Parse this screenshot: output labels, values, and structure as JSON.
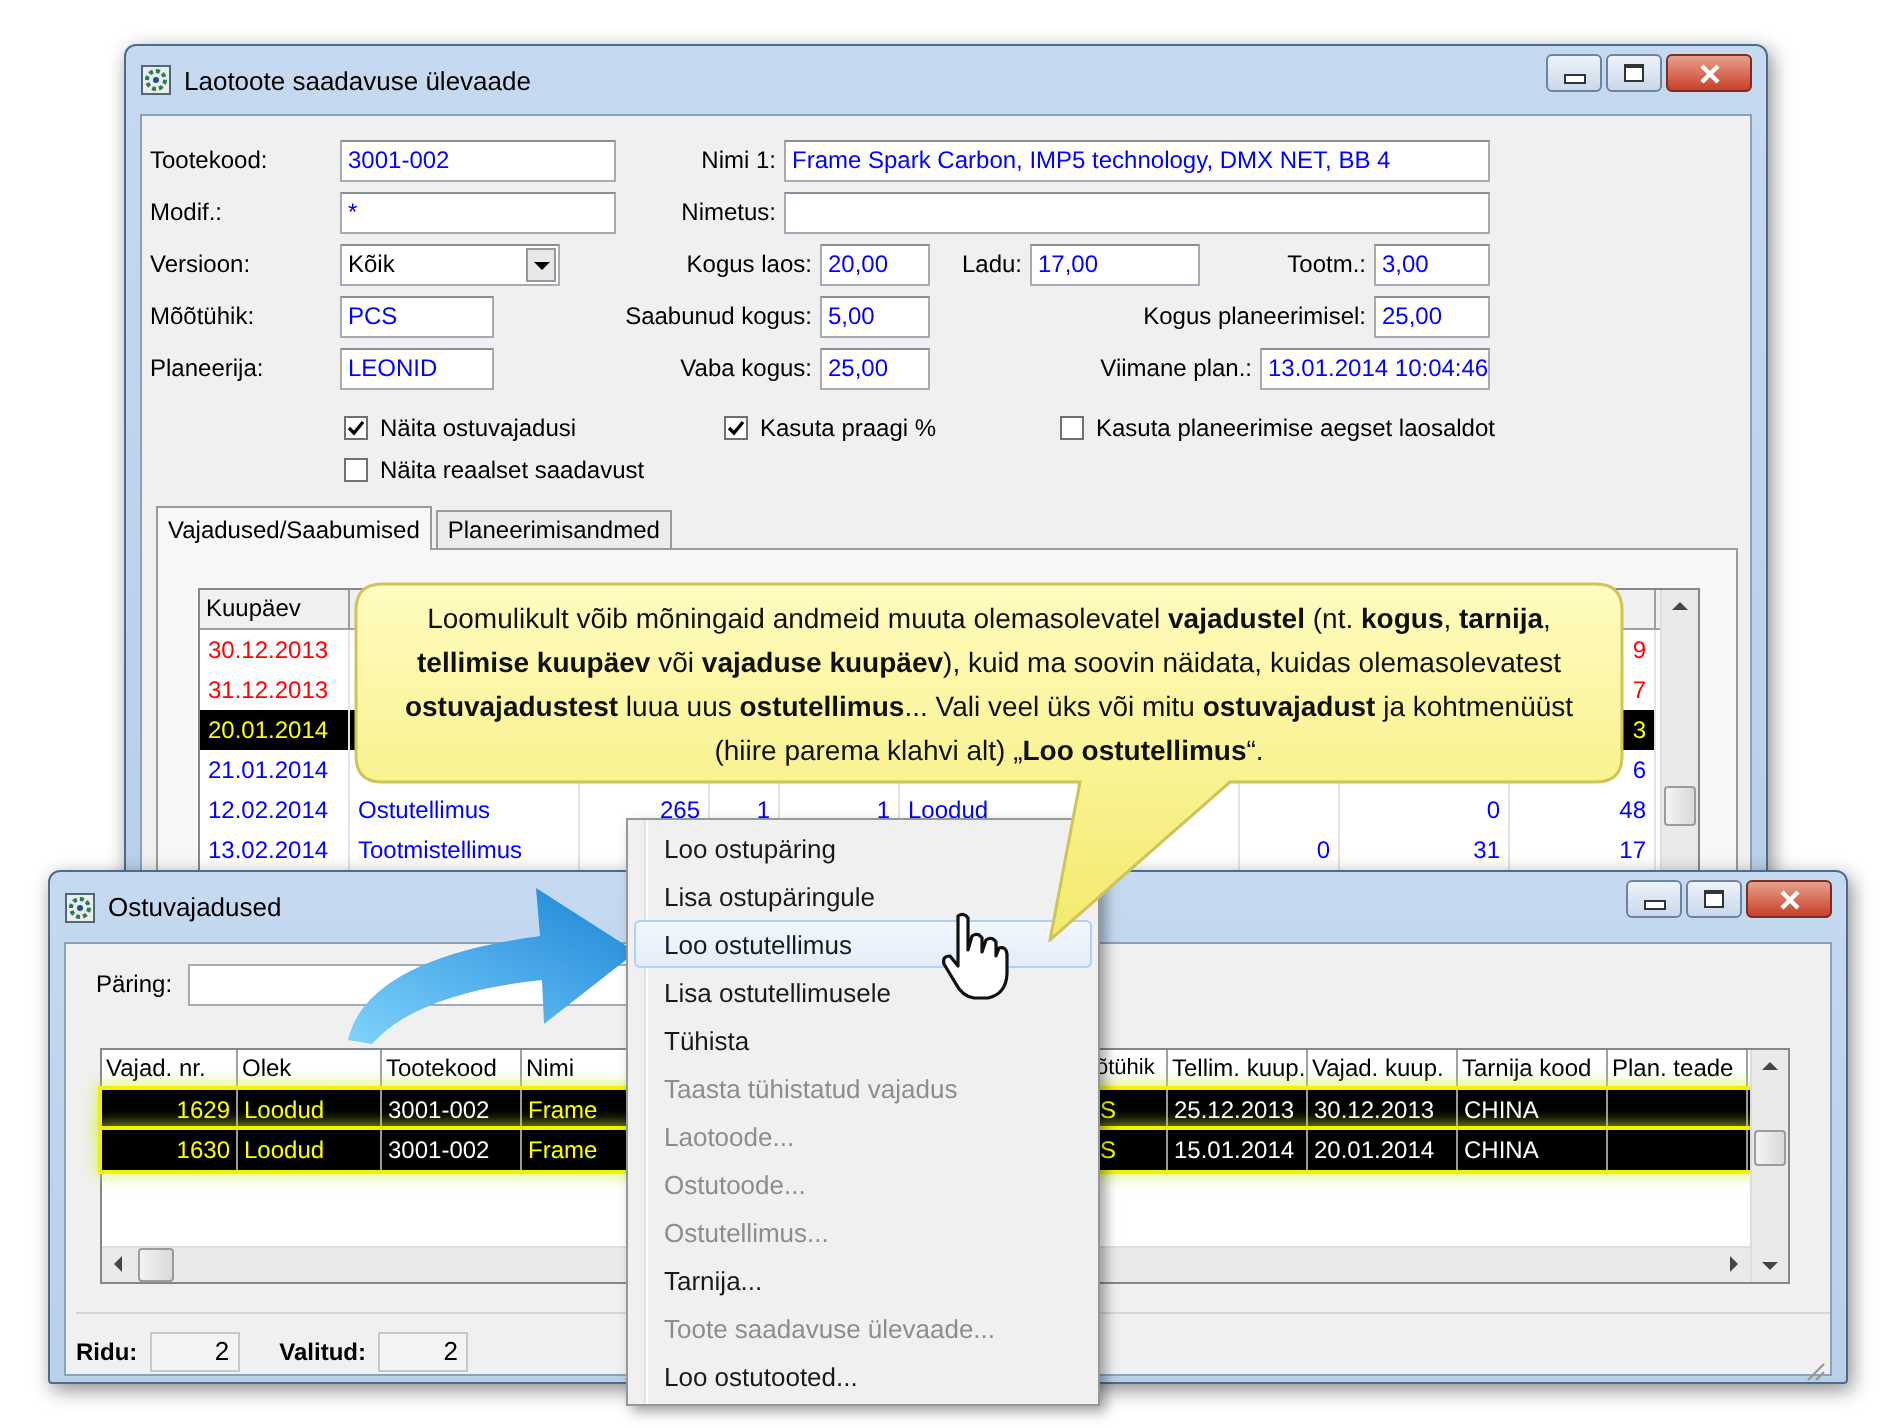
{
  "main_window": {
    "title": "Laotoote saadavuse ülevaade",
    "form_rows": [
      [
        {
          "label": "Tootekood:",
          "value": "3001-002",
          "kind": "text"
        },
        {
          "label": "Nimi 1:",
          "value": "Frame Spark Carbon, IMP5 technology, DMX NET, BB 4",
          "kind": "text"
        }
      ],
      [
        {
          "label": "Modif.:",
          "value": "*",
          "kind": "text"
        },
        {
          "label": "Nimetus:",
          "kind": "text"
        }
      ],
      [
        {
          "label": "Versioon:",
          "value": "Kõik",
          "kind": "combo"
        },
        {
          "label": "Kogus laos:",
          "value": "20,00",
          "kind": "text"
        },
        {
          "label": "Ladu:",
          "value": "17,00",
          "kind": "text"
        },
        {
          "label": "Tootm.:",
          "value": "3,00",
          "kind": "text"
        }
      ],
      [
        {
          "label": "Mõõtühik:",
          "value": "PCS",
          "kind": "text"
        },
        {
          "label": "Saabunud kogus:",
          "value": "5,00",
          "kind": "text"
        },
        {
          "label": "Kogus planeerimisel:",
          "value": "25,00",
          "kind": "text"
        }
      ],
      [
        {
          "label": "Planeerija:",
          "value": "LEONID",
          "kind": "text"
        },
        {
          "label": "Vaba kogus:",
          "value": "25,00",
          "kind": "text"
        },
        {
          "label": "Viimane plan.:",
          "value": "13.01.2014 10:04:46",
          "kind": "text"
        }
      ]
    ],
    "checkboxes": [
      {
        "label": "Näita ostuvajadusi",
        "checked": true
      },
      {
        "label": "Kasuta praagi %",
        "checked": true
      },
      {
        "label": "Kasuta planeerimise aegset laosaldot",
        "checked": false
      },
      {
        "label": "Näita reaalset saadavust",
        "checked": false
      }
    ],
    "tabs": [
      {
        "label": "Vajadused/Saabumised",
        "selected": true
      },
      {
        "label": "Planeerimisandmed",
        "selected": false
      }
    ],
    "table": {
      "columns": [
        "Kuupäev"
      ],
      "rows": [
        {
          "date": "30.12.2013",
          "column_10": "9",
          "color": "#ff0000",
          "selected": false
        },
        {
          "date": "31.12.2013",
          "column_10": "7",
          "color": "#ff0000",
          "selected": false
        },
        {
          "date": "20.01.2014",
          "column_10": "3",
          "selected": true
        },
        {
          "date": "21.01.2014",
          "column_10": "6",
          "color": "#0000ff",
          "selected": false
        },
        {
          "date": "12.02.2014",
          "type": "Ostutellimus",
          "column_3": "265",
          "column_4": "1",
          "column_5": "1",
          "column_6": "Loodud",
          "column_9": "0",
          "column_10": "48",
          "color": "#0000ff",
          "selected": false
        },
        {
          "date": "13.02.2014",
          "type": "Tootmistellimus",
          "column_8": "0",
          "column_9": "31",
          "column_10": "17",
          "color": "#0000ff",
          "selected": false
        }
      ]
    }
  },
  "callout": {
    "text": "Loomulikult võib mõningaid andmeid muuta olemasolevatel **vajadustel** (nt. **kogus**, **tarnija**, **tellimise kuupäev** või **vajaduse kuupäev**), kuid ma soovin näidata, kuidas olemasolevatest **ostuvajadustest** luua uus **ostutellimus**... Vali veel üks või mitu **ostuvajadust** ja kohtmenüüst (hiire parema klahvi alt) „**Loo ostutellimus**“."
  },
  "second_window": {
    "title": "Ostuvajadused",
    "query_label": "Päring:",
    "table": {
      "columns": [
        "Vajad. nr.",
        "Olek",
        "Tootekood",
        "Nimi",
        "õtühik",
        "Tellim. kuup.",
        "Vajad. kuup.",
        "Tarnija kood",
        "Plan. teade"
      ],
      "rows": [
        {
          "cells": [
            "1629",
            "Loodud",
            "3001-002",
            "Frame",
            "S",
            "25.12.2013",
            "30.12.2013",
            "CHINA"
          ],
          "selected": true
        },
        {
          "cells": [
            "1630",
            "Loodud",
            "3001-002",
            "Frame",
            "S",
            "15.01.2014",
            "20.01.2014",
            "CHINA"
          ],
          "selected": true
        }
      ]
    },
    "status": [
      {
        "label": "Ridu:",
        "value": "2"
      },
      {
        "label": "Valitud:",
        "value": "2"
      }
    ]
  },
  "context_menu": {
    "items": [
      {
        "label": "Loo ostupäring",
        "disabled": false,
        "selected": false
      },
      {
        "label": "Lisa ostupäringule",
        "disabled": false,
        "selected": false
      },
      {
        "label": "Loo ostutellimus",
        "disabled": false,
        "selected": true
      },
      {
        "label": "Lisa ostutellimusele",
        "disabled": false,
        "selected": false
      },
      {
        "label": "Tühista",
        "disabled": false,
        "selected": false
      },
      {
        "label": "Taasta tühistatud vajadus",
        "disabled": true,
        "selected": false
      },
      {
        "label": "Laotoode...",
        "disabled": true,
        "selected": false
      },
      {
        "label": "Ostutoode...",
        "disabled": true,
        "selected": false
      },
      {
        "label": "Ostutellimus...",
        "disabled": true,
        "selected": false
      },
      {
        "label": "Tarnija...",
        "disabled": false,
        "selected": false
      },
      {
        "label": "Toote saadavuse ülevaade...",
        "disabled": true,
        "selected": false
      },
      {
        "label": "Loo ostutooted...",
        "disabled": false,
        "selected": false
      }
    ]
  }
}
